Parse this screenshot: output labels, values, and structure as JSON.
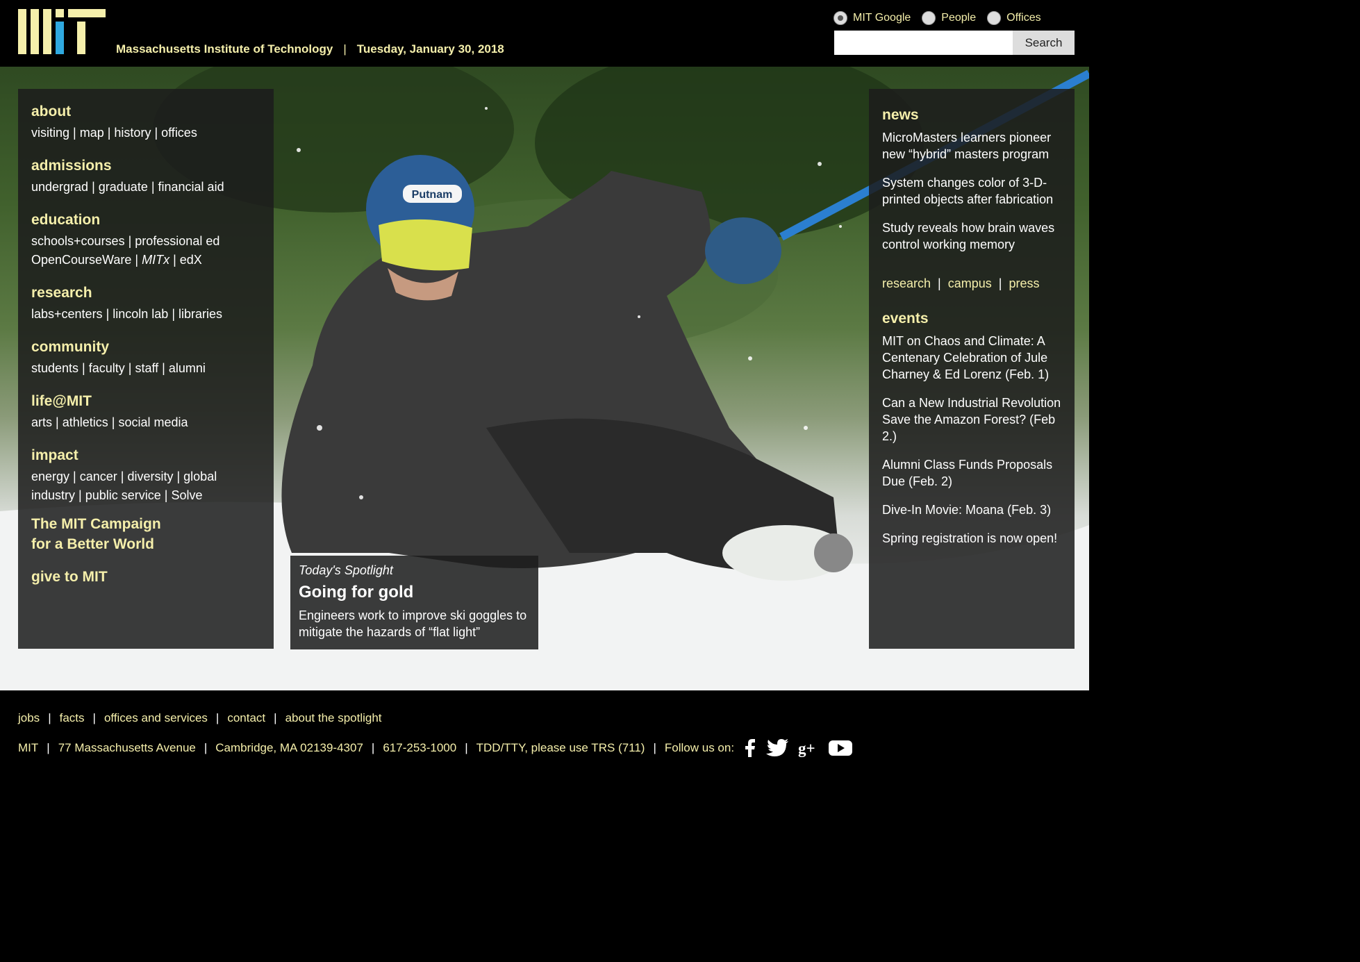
{
  "header": {
    "logo_text": "MIT",
    "institution": "Massachusetts Institute of Technology",
    "separator": "|",
    "date": "Tuesday, January 30, 2018"
  },
  "search": {
    "options": [
      {
        "label": "MIT Google",
        "selected": true
      },
      {
        "label": "People",
        "selected": false
      },
      {
        "label": "Offices",
        "selected": false
      }
    ],
    "placeholder": "",
    "button_label": "Search"
  },
  "left_nav": {
    "sections": [
      {
        "title": "about",
        "lines": [
          [
            "visiting",
            "map",
            "history",
            "offices"
          ]
        ]
      },
      {
        "title": "admissions",
        "lines": [
          [
            "undergrad",
            "graduate",
            "financial aid"
          ]
        ]
      },
      {
        "title": "education",
        "lines": [
          [
            "schools+courses",
            "professional ed"
          ],
          [
            "OpenCourseWare",
            "MITx",
            "edX"
          ]
        ]
      },
      {
        "title": "research",
        "lines": [
          [
            "labs+centers",
            "lincoln lab",
            "libraries"
          ]
        ]
      },
      {
        "title": "community",
        "lines": [
          [
            "students",
            "faculty",
            "staff",
            "alumni"
          ]
        ]
      },
      {
        "title": "life@MIT",
        "lines": [
          [
            "arts",
            "athletics",
            "social media"
          ]
        ]
      },
      {
        "title": "impact",
        "lines": [
          [
            "energy",
            "cancer",
            "diversity",
            "global"
          ],
          [
            "industry",
            "public service",
            "Solve"
          ]
        ]
      }
    ],
    "campaign_line1": "The MIT Campaign",
    "campaign_line2": "for a Better World",
    "give": "give to MIT"
  },
  "spotlight": {
    "kicker": "Today's Spotlight",
    "title": "Going for gold",
    "text": "Engineers work to improve ski goggles to mitigate the hazards of “flat light”",
    "helmet_text": "Putnam"
  },
  "news": {
    "title": "news",
    "items": [
      "MicroMasters learners pioneer new “hybrid” masters program",
      "System changes color of 3-D-printed objects after fabrication",
      "Study reveals how brain waves control working memory"
    ],
    "links": [
      "research",
      "campus",
      "press"
    ]
  },
  "events": {
    "title": "events",
    "items": [
      "MIT on Chaos and Climate: A Centenary Celebration of Jule Charney & Ed Lorenz (Feb. 1)",
      "Can a New Industrial Revolution Save the Amazon Forest? (Feb 2.)",
      "Alumni Class Funds Proposals Due (Feb. 2)",
      "Dive-In Movie: Moana (Feb. 3)",
      "Spring registration is now open!"
    ]
  },
  "footer": {
    "nav": [
      "jobs",
      "facts",
      "offices and services",
      "contact",
      "about the spotlight"
    ],
    "info": [
      "MIT",
      "77 Massachusetts Avenue",
      "Cambridge, MA 02139-4307",
      "617-253-1000",
      "TDD/TTY, please use TRS (711)"
    ],
    "follow": "Follow us on:",
    "social": [
      "facebook-icon",
      "twitter-icon",
      "google-plus-icon",
      "youtube-icon"
    ]
  },
  "colors": {
    "accent_yellow": "#f5efab",
    "logo_blue": "#2fa9e0",
    "panel": "#1c1c1c"
  }
}
